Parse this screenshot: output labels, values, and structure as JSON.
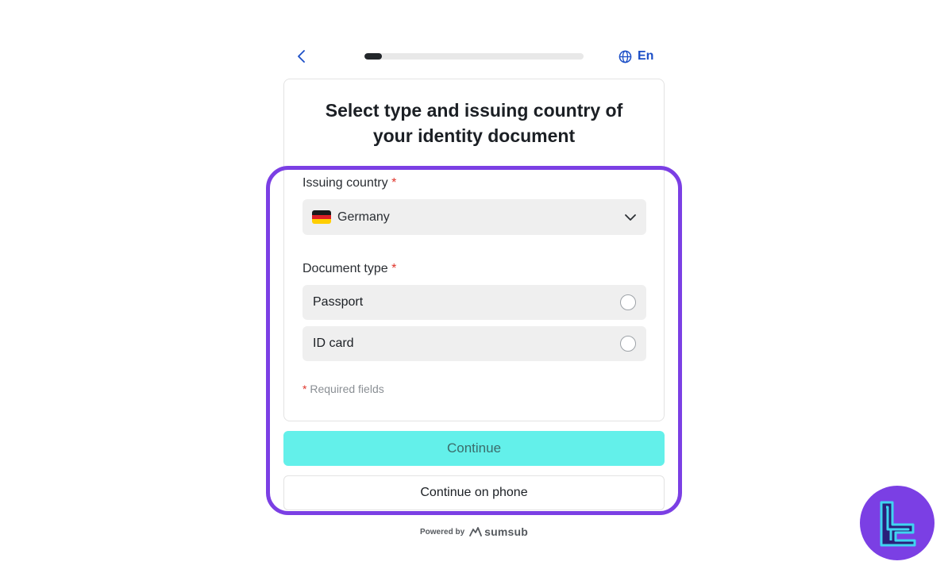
{
  "header": {
    "back_icon": "chevron-left-icon",
    "progress_fraction": 0.08,
    "language_icon": "globe-icon",
    "language_label": "En"
  },
  "form": {
    "title": "Select type and issuing country of your identity document",
    "issuing_country_label": "Issuing country",
    "required_marker": "*",
    "country_value": "Germany",
    "country_flag": "germany-flag-icon",
    "dropdown_icon": "chevron-down-icon",
    "document_type_label": "Document type",
    "document_options": [
      {
        "label": "Passport"
      },
      {
        "label": "ID card"
      }
    ],
    "required_note": "Required fields"
  },
  "actions": {
    "continue_label": "Continue",
    "continue_phone_label": "Continue on phone"
  },
  "footer": {
    "powered_by": "Powered by",
    "brand": "sumsub"
  },
  "colors": {
    "accent_blue": "#1c4fc7",
    "continue_button": "#63f0ea",
    "highlight": "#7b3fe4",
    "required": "#e0352b"
  }
}
